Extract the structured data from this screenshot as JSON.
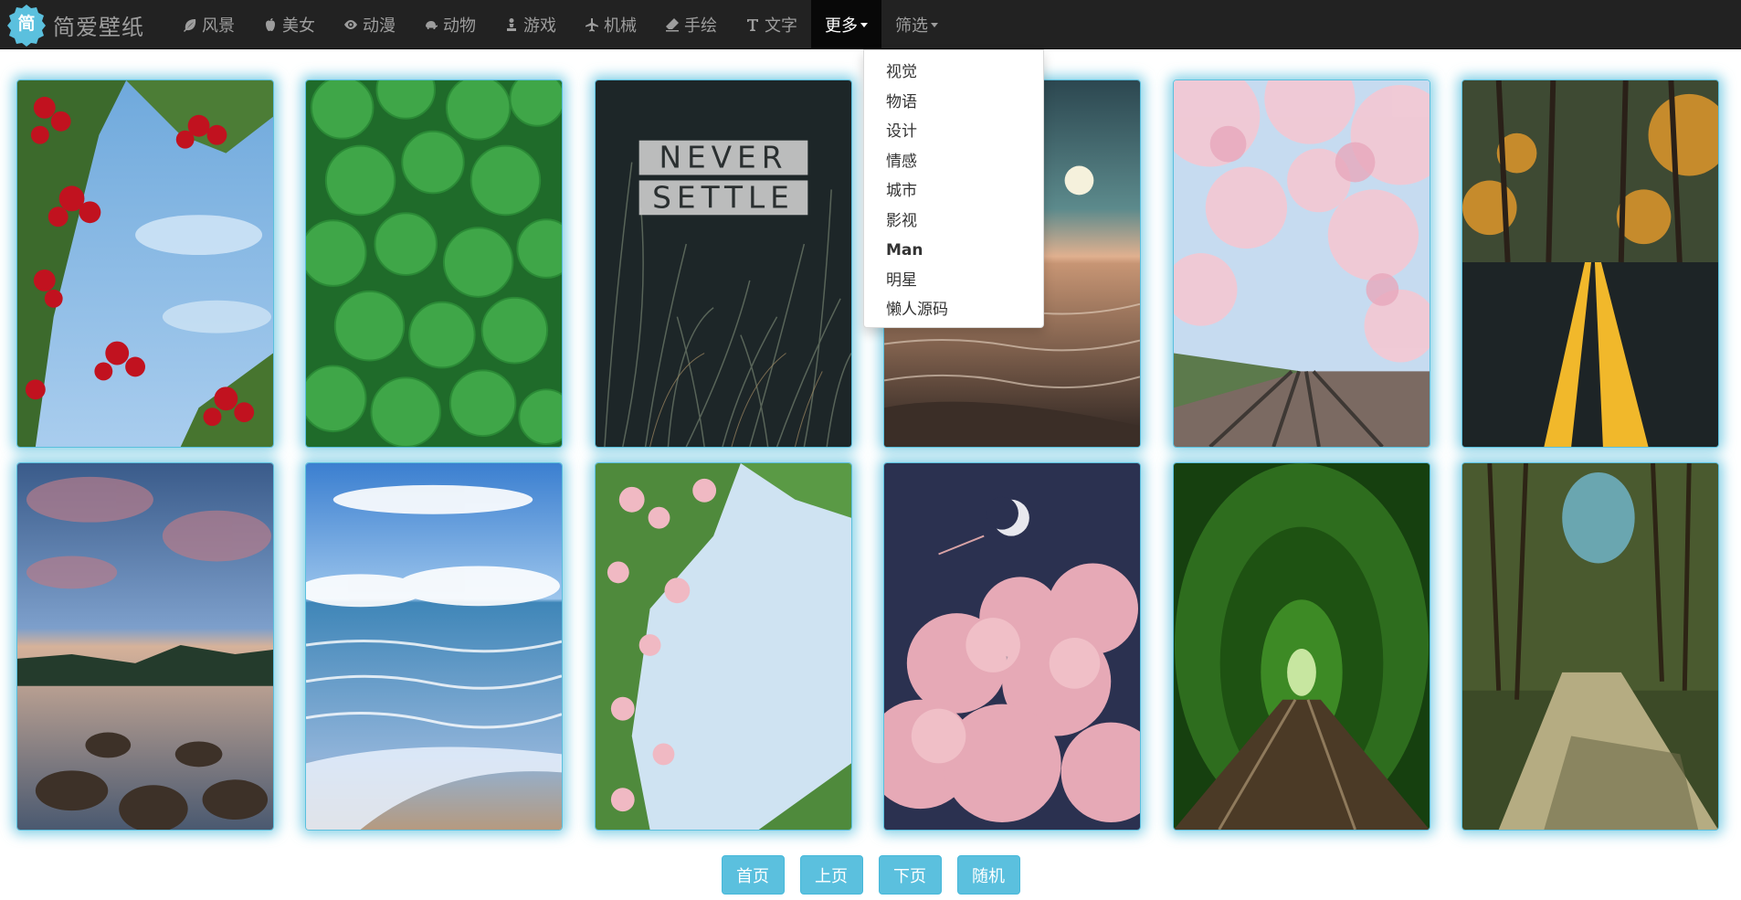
{
  "brand": {
    "logo_char": "简",
    "name": "简爱壁纸"
  },
  "nav": {
    "items": [
      {
        "label": "风景",
        "icon": "leaf-icon"
      },
      {
        "label": "美女",
        "icon": "apple-icon"
      },
      {
        "label": "动漫",
        "icon": "eye-icon"
      },
      {
        "label": "动物",
        "icon": "turtle-icon"
      },
      {
        "label": "游戏",
        "icon": "chess-pawn-icon"
      },
      {
        "label": "机械",
        "icon": "plane-icon"
      },
      {
        "label": "手绘",
        "icon": "eraser-icon"
      },
      {
        "label": "文字",
        "icon": "text-icon"
      }
    ],
    "more_label": "更多",
    "filter_label": "筛选"
  },
  "dropdown": {
    "items": [
      "视觉",
      "物语",
      "设计",
      "情感",
      "城市",
      "影视",
      "Man",
      "明星",
      "懒人源码"
    ]
  },
  "wallpapers": {
    "card3_text_line1": "NEVER",
    "card3_text_line2": "SETTLE",
    "items": [
      {
        "subject": "rowan berries"
      },
      {
        "subject": "clover leaves"
      },
      {
        "subject": "never settle grass"
      },
      {
        "subject": "sunset sea"
      },
      {
        "subject": "cherry blossom railway"
      },
      {
        "subject": "autumn road"
      },
      {
        "subject": "lake rocks dusk"
      },
      {
        "subject": "ocean beach"
      },
      {
        "subject": "wild roses"
      },
      {
        "subject": "moon clouds"
      },
      {
        "subject": "tunnel of love"
      },
      {
        "subject": "country road"
      }
    ]
  },
  "pager": {
    "first": "首页",
    "prev": "上页",
    "next": "下页",
    "random": "随机"
  },
  "colors": {
    "navbar_bg": "#222222",
    "active_bg": "#080808",
    "accent": "#5bc0de",
    "logo": "#5bc0de"
  }
}
